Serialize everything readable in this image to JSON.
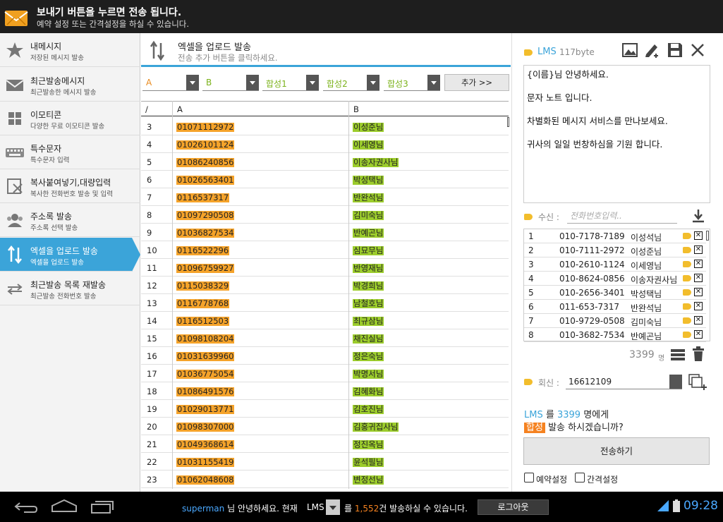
{
  "notice": {
    "title": "보내기 버튼을 누르면 전송 됩니다.",
    "subtitle": "예약 설정 또는 간격설정을 하실 수 있습니다."
  },
  "sidebar": {
    "items": [
      {
        "label": "내메시지",
        "sub": "저장된 메시지 발송",
        "icon": "star-icon"
      },
      {
        "label": "최근발송메시지",
        "sub": "최근발송한 메시지 발송",
        "icon": "envelope-icon"
      },
      {
        "label": "이모티콘",
        "sub": "다양한 무료 이모티콘 발송",
        "icon": "grid-icon"
      },
      {
        "label": "특수문자",
        "sub": "특수문자 입력",
        "icon": "keyboard-icon"
      },
      {
        "label": "복사붙여넣기,대량입력",
        "sub": "복사한 전화번호 발송 및 입력",
        "icon": "paste-icon"
      },
      {
        "label": "주소록 발송",
        "sub": "주소록 선택 발송",
        "icon": "contacts-icon"
      },
      {
        "label": "엑셀을 업로드 발송",
        "sub": "엑셀을 업로드 발송",
        "icon": "updown-icon"
      },
      {
        "label": "최근발송 목록 재발송",
        "sub": "최근발송 전화번호 발송",
        "icon": "repeat-icon"
      }
    ]
  },
  "excel": {
    "title": "엑셀을 업로드 발송",
    "hint": "전송 추가 버튼을 클릭하세요.",
    "selects": [
      "A",
      "B",
      "합성1",
      "합성2",
      "합성3"
    ],
    "add_label": "추가 >>",
    "col_slash": "/",
    "col_a": "A",
    "col_b": "B",
    "rows": [
      {
        "n": "3",
        "a": "01071112972",
        "b": "이성준님"
      },
      {
        "n": "4",
        "a": "01026101124",
        "b": "이세영님"
      },
      {
        "n": "5",
        "a": "01086240856",
        "b": "이송자권사님"
      },
      {
        "n": "6",
        "a": "01026563401",
        "b": "박성택님"
      },
      {
        "n": "7",
        "a": "0116537317",
        "b": "반완석님"
      },
      {
        "n": "8",
        "a": "01097290508",
        "b": "김미숙님"
      },
      {
        "n": "9",
        "a": "01036827534",
        "b": "반예곤님"
      },
      {
        "n": "10",
        "a": "0116522296",
        "b": "심묘무님"
      },
      {
        "n": "11",
        "a": "01096759927",
        "b": "반영재님"
      },
      {
        "n": "12",
        "a": "0115038329",
        "b": "박경희님"
      },
      {
        "n": "13",
        "a": "0116778768",
        "b": "남철호님"
      },
      {
        "n": "14",
        "a": "0116512503",
        "b": "최규삼님"
      },
      {
        "n": "15",
        "a": "01098108204",
        "b": "채진실님"
      },
      {
        "n": "16",
        "a": "01031639960",
        "b": "정은숙님"
      },
      {
        "n": "17",
        "a": "01036775054",
        "b": "박명서님"
      },
      {
        "n": "18",
        "a": "01086491576",
        "b": "김혜화님"
      },
      {
        "n": "19",
        "a": "01029013771",
        "b": "김호진님"
      },
      {
        "n": "20",
        "a": "01098307000",
        "b": "김홍귀집사님"
      },
      {
        "n": "21",
        "a": "01049368614",
        "b": "정진옥님"
      },
      {
        "n": "22",
        "a": "01031155419",
        "b": "윤석필님"
      },
      {
        "n": "23",
        "a": "01062048608",
        "b": "변정선님"
      }
    ]
  },
  "msg": {
    "type": "LMS",
    "bytes": "117byte",
    "lines": [
      "{이름}님 안녕하세요.",
      "문자 노트 입니다.",
      "차별화된 메시지 서비스를 만나보세요.",
      "귀사의 일일 번창하심을 기원 합니다."
    ],
    "recv_label": "수신 :",
    "recv_placeholder": "전화번호입력..",
    "recipients": [
      {
        "n": "1",
        "p": "010-7178-7189",
        "nm": "이성석님"
      },
      {
        "n": "2",
        "p": "010-7111-2972",
        "nm": "이성준님"
      },
      {
        "n": "3",
        "p": "010-2610-1124",
        "nm": "이세영님"
      },
      {
        "n": "4",
        "p": "010-8624-0856",
        "nm": "이송자권사님"
      },
      {
        "n": "5",
        "p": "010-2656-3401",
        "nm": "박성택님"
      },
      {
        "n": "6",
        "p": "011-653-7317",
        "nm": "반완석님"
      },
      {
        "n": "7",
        "p": "010-9729-0508",
        "nm": "김미숙님"
      },
      {
        "n": "8",
        "p": "010-3682-7534",
        "nm": "반예곤님"
      }
    ],
    "count": "3399",
    "count_unit": "명",
    "reply_label": "회신 :",
    "reply_value": "16612109",
    "summary_type": "LMS",
    "summary_mid": "를",
    "summary_count": "3399",
    "summary_end": "명에게",
    "summary_badge": "합성",
    "summary_line2": "발송 하시겠습니까?",
    "send_label": "전송하기",
    "reserve_label": "예약설정",
    "interval_label": "간격설정"
  },
  "status": {
    "user": "superman",
    "greet": "님 안녕하세요. 현재",
    "type": "LMS",
    "mid": "를",
    "remain": "1,552",
    "end": "건 발송하실 수 있습니다.",
    "logout": "로그아웃",
    "time": "09:28"
  }
}
